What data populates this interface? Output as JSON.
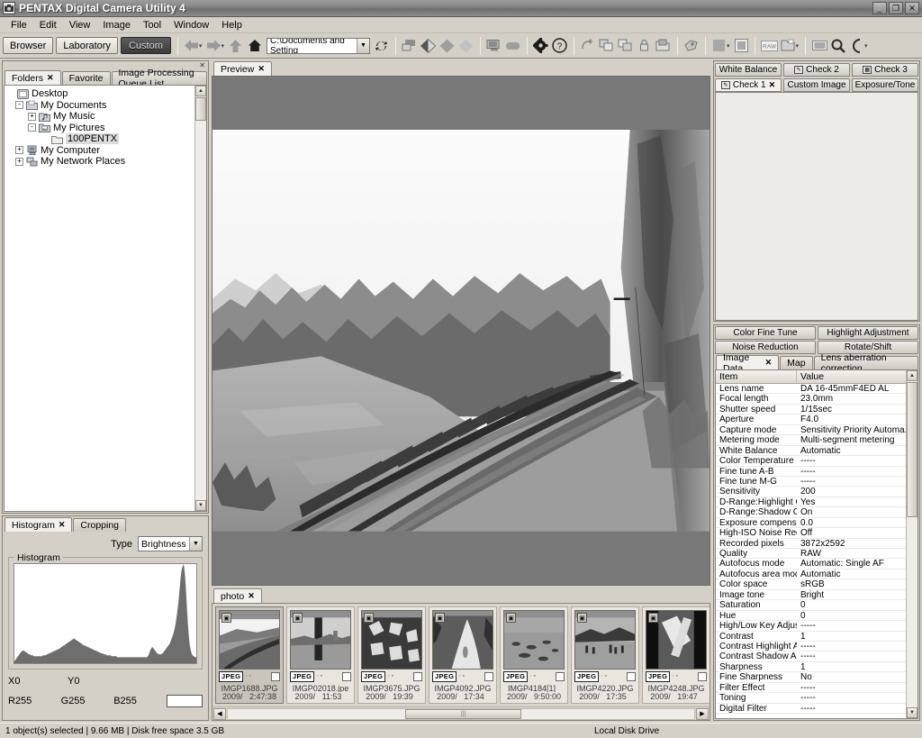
{
  "window": {
    "title": "PENTAX Digital Camera Utility 4",
    "app_icon": "camera-icon",
    "minimize": "_",
    "maximize": "❐",
    "close": "✕"
  },
  "menu": [
    "File",
    "Edit",
    "View",
    "Image",
    "Tool",
    "Window",
    "Help"
  ],
  "toolbar": {
    "modes": [
      {
        "label": "Browser",
        "active": false
      },
      {
        "label": "Laboratory",
        "active": false
      },
      {
        "label": "Custom",
        "active": true
      }
    ],
    "path_value": "C:\\Documents and Setting",
    "icons": [
      "back-arrow-icon",
      "forward-arrow-icon",
      "up-arrow-icon",
      "home-icon",
      "refresh-icon",
      "display-icon",
      "diamond-half-icon",
      "diamond-gray-icon",
      "diamond-light-icon",
      "monitor-icon",
      "capsule-icon",
      "gear-icon",
      "help-icon",
      "undo-icon",
      "copy-icon",
      "paste-icon",
      "lock-icon",
      "folder-open-icon",
      "tag-icon",
      "square-icon",
      "frame-icon",
      "raw-icon",
      "folder-icon",
      "filmstrip-icon",
      "search-icon",
      "zoom-icon"
    ]
  },
  "left_panel": {
    "tabs": [
      {
        "label": "Folders",
        "active": true,
        "closable": true
      },
      {
        "label": "Favorite",
        "active": false,
        "closable": false
      },
      {
        "label": "Image Processing Queue List",
        "active": false,
        "closable": false
      }
    ],
    "tree": [
      {
        "label": "Desktop",
        "indent": 0,
        "expander": "none",
        "icon": "desktop-icon",
        "selected": false
      },
      {
        "label": "My Documents",
        "indent": 1,
        "expander": "-",
        "icon": "folder-icon",
        "selected": false
      },
      {
        "label": "My Music",
        "indent": 2,
        "expander": "+",
        "icon": "music-folder-icon",
        "selected": false
      },
      {
        "label": "My Pictures",
        "indent": 2,
        "expander": "-",
        "icon": "pictures-folder-icon",
        "selected": false
      },
      {
        "label": "100PENTX",
        "indent": 3,
        "expander": "none",
        "icon": "folder-icon",
        "selected": true
      },
      {
        "label": "My Computer",
        "indent": 1,
        "expander": "+",
        "icon": "computer-icon",
        "selected": false
      },
      {
        "label": "My Network Places",
        "indent": 1,
        "expander": "+",
        "icon": "network-icon",
        "selected": false
      }
    ]
  },
  "histogram_panel": {
    "tabs": [
      {
        "label": "Histogram",
        "active": true,
        "closable": true
      },
      {
        "label": "Cropping",
        "active": false,
        "closable": false
      }
    ],
    "type_label": "Type",
    "type_value": "Brightness",
    "group_legend": "Histogram",
    "readout": {
      "x_label": "X0",
      "y_label": "Y0",
      "r_label": "R255",
      "g_label": "G255",
      "b_label": "B255",
      "swatch_color": "#ffffff"
    }
  },
  "chart_data": {
    "type": "area",
    "title": "Histogram",
    "xlabel": "",
    "ylabel": "",
    "xlim": [
      0,
      255
    ],
    "ylim": [
      0,
      100
    ],
    "grid": false,
    "legend": "none",
    "series": [
      {
        "name": "Brightness",
        "values": [
          2,
          3,
          4,
          5,
          6,
          7,
          8,
          9,
          10,
          11,
          12,
          12,
          13,
          13,
          12,
          12,
          11,
          11,
          10,
          10,
          9,
          9,
          9,
          8,
          8,
          8,
          8,
          7,
          7,
          7,
          7,
          7,
          7,
          7,
          7,
          7,
          7,
          7,
          7,
          7,
          8,
          8,
          8,
          8,
          8,
          9,
          9,
          9,
          10,
          10,
          10,
          11,
          11,
          11,
          12,
          12,
          12,
          13,
          13,
          13,
          14,
          14,
          14,
          15,
          15,
          16,
          16,
          17,
          17,
          18,
          18,
          19,
          19,
          20,
          20,
          21,
          21,
          22,
          22,
          23,
          23,
          24,
          24,
          25,
          25,
          24,
          24,
          23,
          23,
          22,
          22,
          21,
          21,
          20,
          20,
          19,
          19,
          18,
          18,
          18,
          17,
          17,
          17,
          16,
          16,
          16,
          15,
          15,
          15,
          14,
          14,
          14,
          13,
          13,
          13,
          12,
          12,
          12,
          11,
          11,
          11,
          10,
          10,
          10,
          10,
          9,
          9,
          9,
          9,
          8,
          8,
          8,
          8,
          8,
          8,
          8,
          7,
          7,
          7,
          7,
          7,
          7,
          7,
          7,
          6,
          6,
          6,
          6,
          6,
          6,
          6,
          6,
          6,
          6,
          6,
          6,
          6,
          6,
          6,
          6,
          6,
          6,
          6,
          6,
          6,
          6,
          6,
          6,
          6,
          6,
          6,
          6,
          6,
          6,
          6,
          6,
          6,
          6,
          6,
          6,
          6,
          6,
          6,
          6,
          6,
          6,
          6,
          7,
          8,
          10,
          12,
          14,
          15,
          16,
          16,
          15,
          14,
          13,
          12,
          11,
          10,
          10,
          9,
          9,
          9,
          9,
          9,
          10,
          10,
          11,
          12,
          13,
          14,
          15,
          16,
          17,
          18,
          19,
          20,
          22,
          24,
          26,
          28,
          30,
          33,
          36,
          40,
          45,
          50,
          56,
          62,
          70,
          78,
          86,
          92,
          96,
          98,
          100,
          97,
          90,
          80,
          68,
          55,
          42,
          32,
          24,
          18,
          14,
          11,
          9,
          8,
          7,
          7,
          6,
          6,
          6
        ]
      }
    ]
  },
  "preview": {
    "tabs": [
      {
        "label": "Preview",
        "active": true,
        "closable": true
      }
    ],
    "image_description": "black and white photo of railway track along cliff over river"
  },
  "thumbs_panel": {
    "tabs": [
      {
        "label": "photo",
        "active": true,
        "closable": true
      }
    ],
    "items": [
      {
        "name": "IMGP1688.JPG",
        "date": "2009/_   2:47:38",
        "format": "JPEG",
        "selected": true,
        "scene": "railway"
      },
      {
        "name": "IMGP02018.jpe",
        "date": "2009/_   11:53_",
        "format": "JPEG",
        "selected": false,
        "scene": "pole"
      },
      {
        "name": "IMGP3675.JPG",
        "date": "2009/_   19:39_",
        "format": "JPEG",
        "selected": false,
        "scene": "leaves"
      },
      {
        "name": "IMGP4092.JPG",
        "date": "2009/_   17:34_",
        "format": "JPEG",
        "selected": false,
        "scene": "path"
      },
      {
        "name": "IMGP4184[1]_",
        "date": "2009/_   9:50:00",
        "format": "JPEG",
        "selected": false,
        "scene": "water"
      },
      {
        "name": "IMGP4220.JPG",
        "date": "2009/_   17:35_",
        "format": "JPEG",
        "selected": false,
        "scene": "lake"
      },
      {
        "name": "IMGP4248.JPG",
        "date": "2009/_   19:47_",
        "format": "JPEG",
        "selected": false,
        "scene": "object"
      }
    ]
  },
  "right_top": {
    "tabs_row1": [
      {
        "label": "White Balance",
        "active": false,
        "icon": null
      },
      {
        "label": "Check 2",
        "active": false,
        "icon": "check2-icon"
      },
      {
        "label": "Check 3",
        "active": false,
        "icon": "check3-icon"
      }
    ],
    "tabs_row2": [
      {
        "label": "Check 1",
        "active": true,
        "icon": "check1-icon",
        "closable": true
      },
      {
        "label": "Custom Image",
        "active": false,
        "icon": null
      },
      {
        "label": "Exposure/Tone",
        "active": false,
        "icon": null
      }
    ]
  },
  "right_bottom": {
    "tool_tabs_row1": [
      "Color Fine Tune",
      "Highlight Adjustment"
    ],
    "tool_tabs_row2": [
      "Noise Reduction",
      "Rotate/Shift"
    ],
    "tabs_row3": [
      {
        "label": "Image Data",
        "active": true,
        "closable": true
      },
      {
        "label": "Map",
        "active": false,
        "closable": false
      },
      {
        "label": "Lens aberration correction",
        "active": false,
        "closable": false
      }
    ],
    "columns": [
      "Item",
      "Value"
    ],
    "rows": [
      [
        "Lens name",
        "DA 16-45mmF4ED AL"
      ],
      [
        "Focal length",
        "23.0mm"
      ],
      [
        "Shutter speed",
        "1/15sec"
      ],
      [
        "Aperture",
        "F4.0"
      ],
      [
        "Capture mode",
        "Sensitivity Priority Automa..."
      ],
      [
        "Metering mode",
        "Multi-segment metering"
      ],
      [
        "White Balance",
        "Automatic"
      ],
      [
        "Color Temperature",
        "-----"
      ],
      [
        "Fine tune A-B",
        "-----"
      ],
      [
        "Fine tune M-G",
        "-----"
      ],
      [
        "Sensitivity",
        "200"
      ],
      [
        "D-Range:Highlight Co...",
        "Yes"
      ],
      [
        "D-Range:Shadow Co...",
        "On"
      ],
      [
        "Exposure compensation",
        "0.0"
      ],
      [
        "High-ISO Noise Redu...",
        "Off"
      ],
      [
        "Recorded pixels",
        "3872x2592"
      ],
      [
        "Quality",
        "RAW"
      ],
      [
        "Autofocus mode",
        "Automatic: Single AF"
      ],
      [
        "Autofocus area mode",
        "Automatic"
      ],
      [
        "Color space",
        "sRGB"
      ],
      [
        "Image tone",
        "Bright"
      ],
      [
        "Saturation",
        "0"
      ],
      [
        "Hue",
        "0"
      ],
      [
        "High/Low Key Adjust...",
        "-----"
      ],
      [
        "Contrast",
        "1"
      ],
      [
        "Contrast Highlight Ad...",
        "-----"
      ],
      [
        "Contrast Shadow Adj...",
        "-----"
      ],
      [
        "Sharpness",
        "1"
      ],
      [
        "Fine Sharpness",
        "No"
      ],
      [
        "Filter Effect",
        "-----"
      ],
      [
        "Toning",
        "-----"
      ],
      [
        "Digital Filter",
        "-----"
      ]
    ]
  },
  "statusbar": {
    "left": "1 object(s) selected | 9.66 MB | Disk free space 3.5 GB",
    "right": "Local Disk Drive"
  }
}
